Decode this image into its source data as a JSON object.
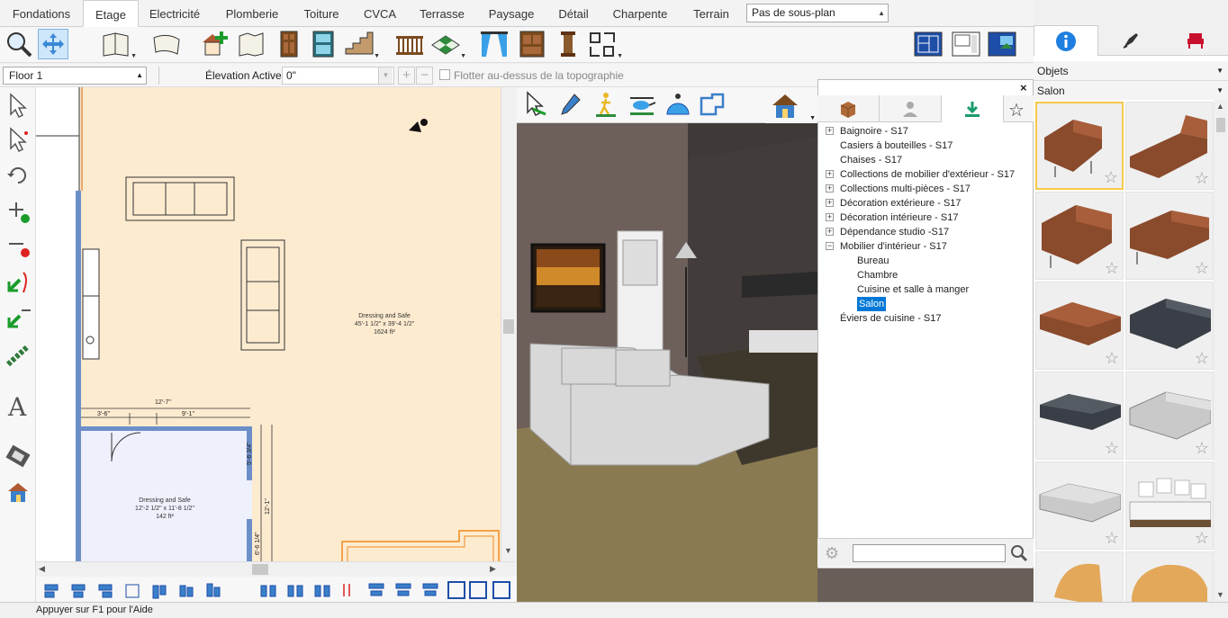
{
  "tabs": [
    "Fondations",
    "Etage",
    "Electricité",
    "Plomberie",
    "Toiture",
    "CVCA",
    "Terrasse",
    "Paysage",
    "Détail",
    "Charpente",
    "Terrain"
  ],
  "active_tab": "Etage",
  "subplan": {
    "value": "Pas de sous-plan"
  },
  "floorbar": {
    "floor": "Floor 1",
    "elevation_label": "Élevation Active:",
    "elevation_value": "0\"",
    "float_label": "Flotter au-dessus de la topographie"
  },
  "plan": {
    "room1": {
      "name": "Dressing and Safe",
      "dims": "45'-1 1/2\" x 39'-4 1/2\"",
      "area": "1624 ft²"
    },
    "room2": {
      "name": "Dressing and Safe",
      "dims": "12'-2 1/2\" x 11'-8 1/2\"",
      "area": "142 ft²"
    },
    "dim_top": "12'-7\"",
    "dim_left": "3'-6\"",
    "dim_right": "9'-1\"",
    "dim_v1": "5'-6 3/4\"",
    "dim_v2": "12'-1\"",
    "dim_v3": "6'-6 1/4\""
  },
  "library": {
    "tree": [
      {
        "label": "Baignoire - S17",
        "expandable": true
      },
      {
        "label": "Casiers à bouteilles - S17",
        "expandable": false
      },
      {
        "label": "Chaises - S17",
        "expandable": false
      },
      {
        "label": "Collections de mobilier d'extérieur - S17",
        "expandable": true
      },
      {
        "label": "Collections multi-pièces - S17",
        "expandable": true
      },
      {
        "label": "Décoration extérieure - S17",
        "expandable": true
      },
      {
        "label": "Décoration intérieure - S17",
        "expandable": true
      },
      {
        "label": "Dépendance studio -S17",
        "expandable": true
      },
      {
        "label": "Mobilier d'intérieur - S17",
        "expandable": true,
        "expanded": true
      },
      {
        "label": "Bureau",
        "child": true
      },
      {
        "label": "Chambre",
        "child": true
      },
      {
        "label": "Cuisine et salle à manger",
        "child": true
      },
      {
        "label": "Salon",
        "child": true,
        "selected": true
      },
      {
        "label": "Éviers de cuisine - S17",
        "expandable": false
      }
    ]
  },
  "rightpanel": {
    "category": "Objets",
    "subcategory": "Salon"
  },
  "status": "Appuyer sur F1 pour l'Aide",
  "colors": {
    "accent": "#0078d7",
    "plan_floor": "#fdebd0",
    "sofa_brown": "#8a4a2c",
    "sofa_dark": "#3a3f47"
  }
}
